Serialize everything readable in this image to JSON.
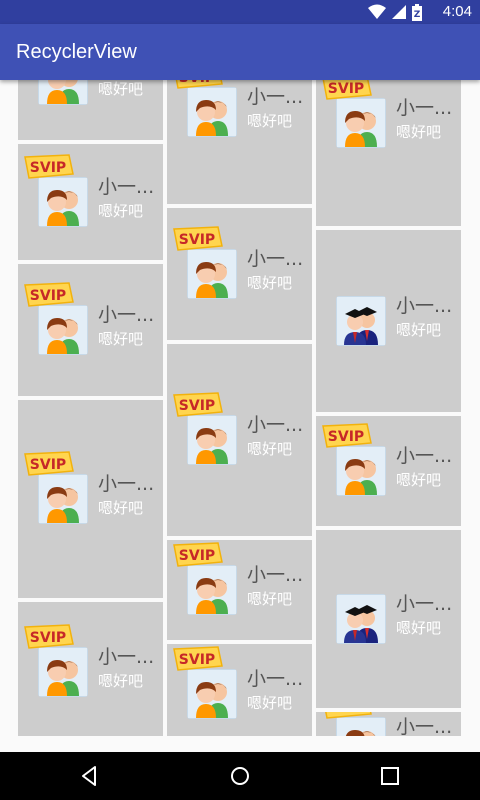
{
  "status_bar": {
    "time": "4:04",
    "battery_label": "Z"
  },
  "app_bar": {
    "title": "RecyclerView"
  },
  "items": [
    {
      "name": "小一...",
      "message": "嗯好吧",
      "vip": true,
      "vip_label": "SVIP",
      "avatar": "couple-icon"
    },
    {
      "name": "小一...",
      "message": "嗯好吧",
      "vip": false,
      "vip_label": "",
      "avatar": "graduates-icon"
    }
  ],
  "colors": {
    "primary": "#3f51b5",
    "primary_dark": "#303f9f",
    "card": "#cdcdcd",
    "vip_gold": "#ffd54f"
  }
}
